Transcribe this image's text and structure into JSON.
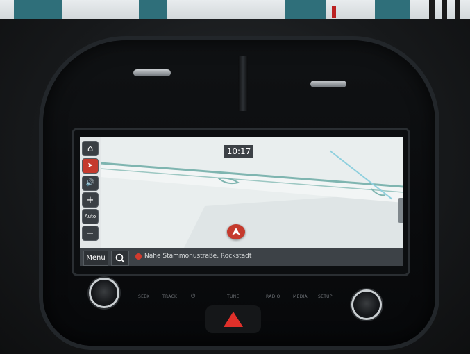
{
  "screen": {
    "clock": "10:17",
    "sidebar": {
      "home_icon": "home-icon",
      "nav_icon": "compass-icon",
      "sound_icon": "speaker-icon",
      "zoom_in": "+",
      "auto_label": "Auto",
      "zoom_out": "−"
    },
    "bottombar": {
      "menu_label": "Menu",
      "search_icon": "search-icon",
      "street": "Nahe Stammonustraße, Rockstadt"
    },
    "colors": {
      "map_bg": "#e9eeee",
      "road": "#7fb5b0",
      "marker": "#c53a2d",
      "hazard": "#e0302a"
    }
  },
  "hard_buttons": {
    "labels": [
      "SEEK",
      "TRACK",
      "⏻",
      "TUNE",
      "RADIO",
      "MEDIA",
      "SETUP"
    ]
  }
}
